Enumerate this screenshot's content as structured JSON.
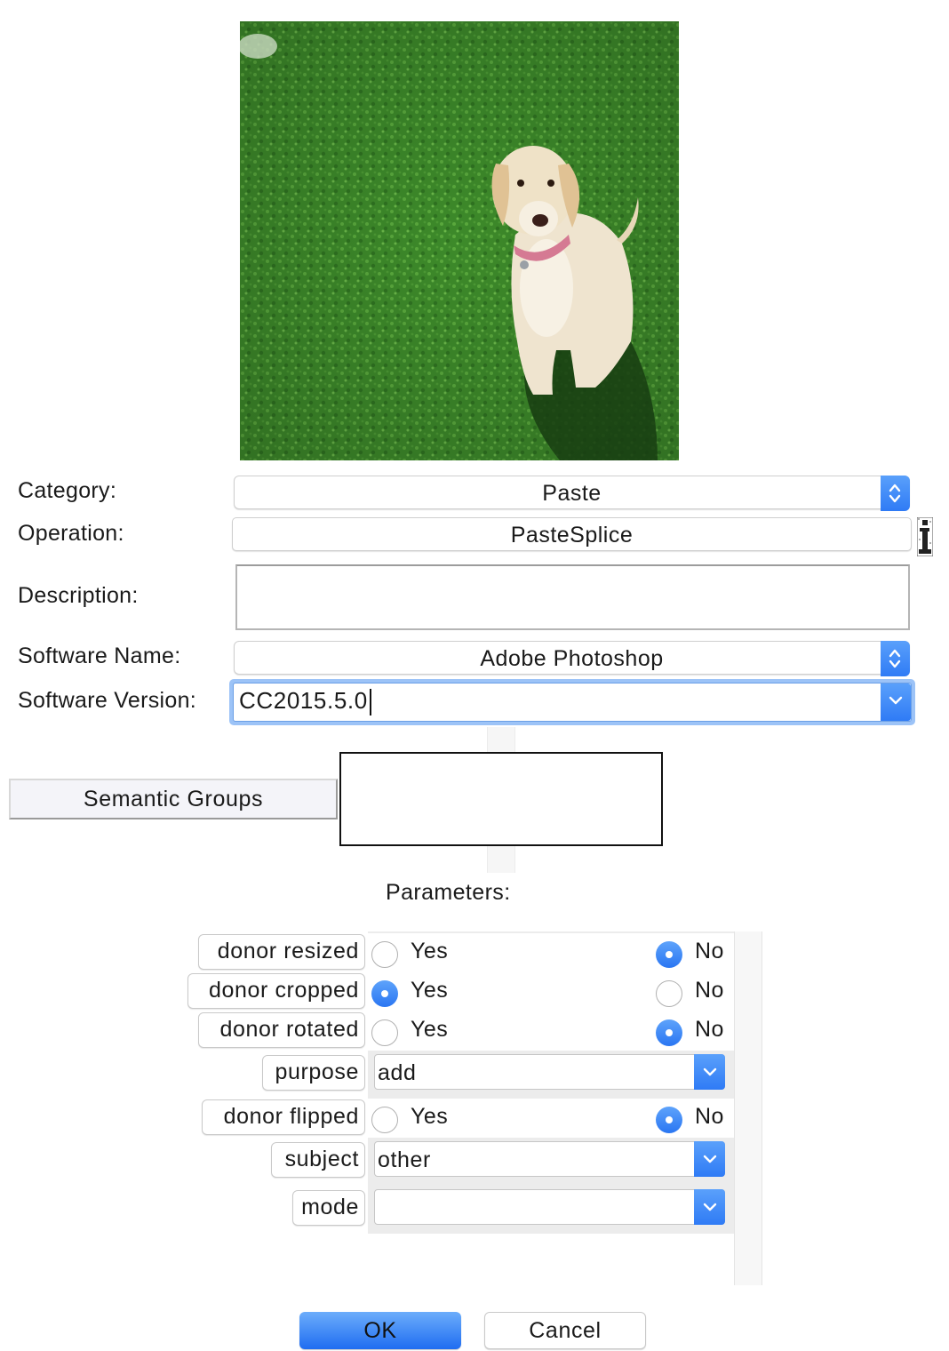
{
  "form": {
    "category_label": "Category:",
    "category_value": "Paste",
    "operation_label": "Operation:",
    "operation_value": "PasteSplice",
    "description_label": "Description:",
    "description_value": "",
    "software_name_label": "Software Name:",
    "software_name_value": "Adobe Photoshop",
    "software_version_label": "Software Version:",
    "software_version_value": "CC2015.5.0"
  },
  "semantic": {
    "button_label": "Semantic Groups"
  },
  "parameters": {
    "title": "Parameters:",
    "yes_label": "Yes",
    "no_label": "No",
    "donor_resized": {
      "label": "donor resized",
      "selected": "No"
    },
    "donor_cropped": {
      "label": "donor cropped",
      "selected": "Yes"
    },
    "donor_rotated": {
      "label": "donor rotated",
      "selected": "No"
    },
    "purpose": {
      "label": "purpose",
      "value": "add"
    },
    "donor_flipped": {
      "label": "donor flipped",
      "selected": "No"
    },
    "subject": {
      "label": "subject",
      "value": "other"
    },
    "mode": {
      "label": "mode",
      "value": ""
    }
  },
  "buttons": {
    "ok": "OK",
    "cancel": "Cancel"
  },
  "colors": {
    "accent": "#2f7bf5",
    "grass": "#3f8a2c"
  }
}
